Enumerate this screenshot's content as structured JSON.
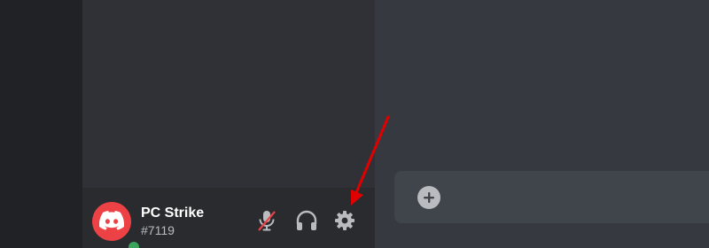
{
  "user": {
    "name": "PC Strike",
    "discriminator": "#7119",
    "avatar_color": "#ed4245",
    "status": "online",
    "status_color": "#3ba55d"
  },
  "controls": {
    "mute_icon": "microphone-muted-icon",
    "deafen_icon": "headphones-icon",
    "settings_icon": "gear-icon"
  },
  "composer": {
    "attach_icon": "plus-circle-icon"
  },
  "annotation": {
    "arrow_color": "#e00000"
  }
}
